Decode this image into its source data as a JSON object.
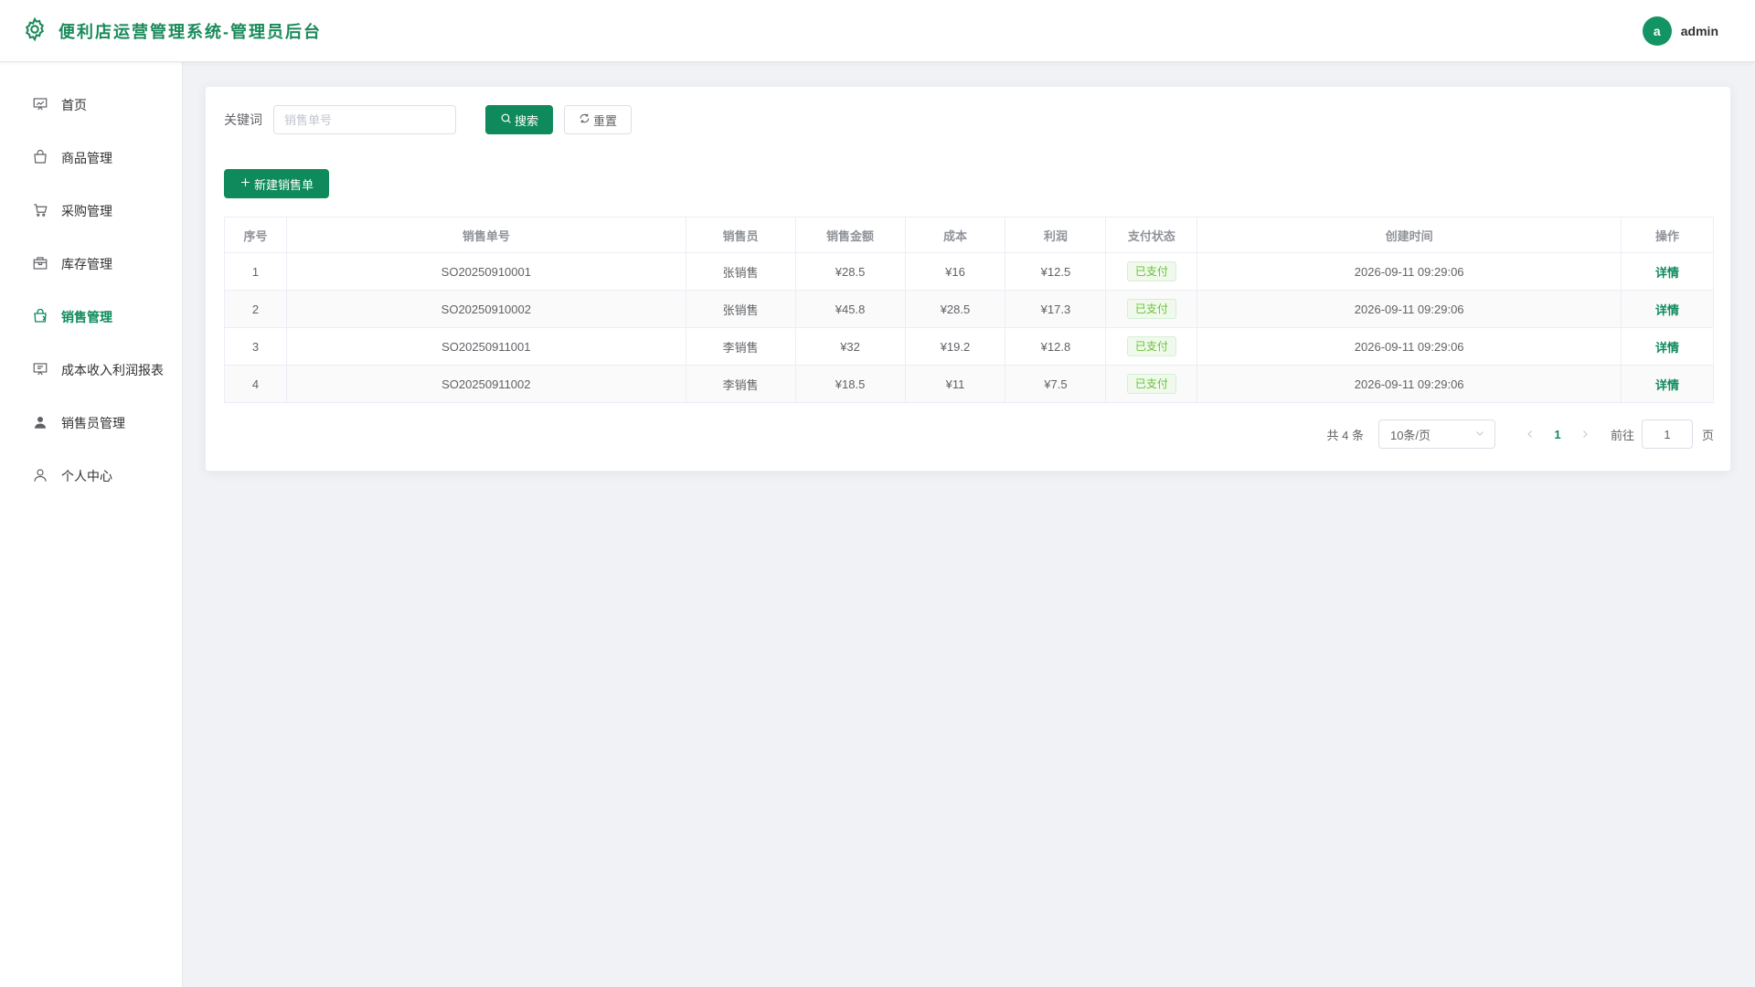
{
  "header": {
    "title": "便利店运营管理系统-管理员后台",
    "avatar_letter": "a",
    "username": "admin",
    "logo_icon": "gear-icon"
  },
  "sidebar": {
    "items": [
      {
        "label": "首页",
        "icon": "presentation-chart-icon",
        "active": false
      },
      {
        "label": "商品管理",
        "icon": "shopping-bag-icon",
        "active": false
      },
      {
        "label": "采购管理",
        "icon": "shopping-cart-icon",
        "active": false
      },
      {
        "label": "库存管理",
        "icon": "box-icon",
        "active": false
      },
      {
        "label": "销售管理",
        "icon": "sale-bag-icon",
        "active": true
      },
      {
        "label": "成本收入利润报表",
        "icon": "report-board-icon",
        "active": false
      },
      {
        "label": "销售员管理",
        "icon": "user-filled-icon",
        "active": false
      },
      {
        "label": "个人中心",
        "icon": "user-outline-icon",
        "active": false
      }
    ]
  },
  "search": {
    "label": "关键词",
    "placeholder": "销售单号",
    "value": "",
    "search_button": "搜索",
    "reset_button": "重置"
  },
  "actions": {
    "new_button": "新建销售单"
  },
  "table": {
    "columns": [
      "序号",
      "销售单号",
      "销售员",
      "销售金额",
      "成本",
      "利润",
      "支付状态",
      "创建时间",
      "操作"
    ],
    "rows": [
      {
        "index": "1",
        "order_no": "SO20250910001",
        "seller": "张销售",
        "amount": "¥28.5",
        "cost": "¥16",
        "profit": "¥12.5",
        "status": "已支付",
        "created": "2026-09-11 09:29:06",
        "action": "详情"
      },
      {
        "index": "2",
        "order_no": "SO20250910002",
        "seller": "张销售",
        "amount": "¥45.8",
        "cost": "¥28.5",
        "profit": "¥17.3",
        "status": "已支付",
        "created": "2026-09-11 09:29:06",
        "action": "详情"
      },
      {
        "index": "3",
        "order_no": "SO20250911001",
        "seller": "李销售",
        "amount": "¥32",
        "cost": "¥19.2",
        "profit": "¥12.8",
        "status": "已支付",
        "created": "2026-09-11 09:29:06",
        "action": "详情"
      },
      {
        "index": "4",
        "order_no": "SO20250911002",
        "seller": "李销售",
        "amount": "¥18.5",
        "cost": "¥11",
        "profit": "¥7.5",
        "status": "已支付",
        "created": "2026-09-11 09:29:06",
        "action": "详情"
      }
    ]
  },
  "pagination": {
    "total": "共 4 条",
    "page_size": "10条/页",
    "current_page": "1",
    "goto_label": "前往",
    "goto_value": "1",
    "page_suffix": "页"
  },
  "colors": {
    "brand": "#0f8a5c",
    "tag_success": "#67c23a"
  }
}
